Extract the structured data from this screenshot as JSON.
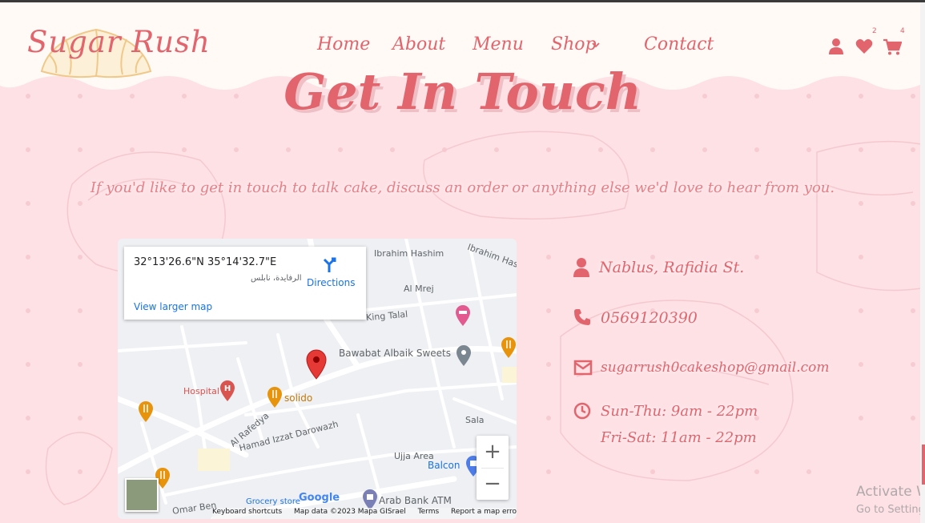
{
  "colors": {
    "accent": "#e2646d",
    "background": "#fde1e5",
    "header_bg": "#fffaf6",
    "link_blue": "#1a73e8"
  },
  "header": {
    "logo_text": "Sugar Rush",
    "nav": [
      {
        "label": "Home"
      },
      {
        "label": "About"
      },
      {
        "label": "Menu"
      },
      {
        "label": "Shop"
      },
      {
        "label": "Contact"
      }
    ],
    "shop_dropdown_icon": "chevron-down-icon",
    "icons": {
      "user": "user-icon",
      "wishlist": "heart-icon",
      "cart": "cart-icon"
    },
    "wishlist_count": "2",
    "cart_count": "4"
  },
  "hero": {
    "title": "Get In Touch",
    "subtitle": "If you'd like to get in touch to talk cake, discuss an order or anything else we'd love to hear from you."
  },
  "map": {
    "coordinates": "32°13'26.6\"N 35°14'32.7\"E",
    "address": "الرفايدة، نابلس",
    "directions_label": "Directions",
    "view_larger_label": "View larger map",
    "road_labels": [
      "Ibrahim Hashim",
      "Ibrahim Hash",
      "Al Mrej",
      "King Talal",
      "Al Rafedya",
      "Hamad Izzat Darowazh",
      "Ujja Area",
      "Sala",
      "Omar Ben"
    ],
    "pois": [
      {
        "label": "Bawabat Albaik Sweets",
        "color": "#5f6368"
      },
      {
        "label": "Hospital",
        "color": "#d9534f"
      },
      {
        "label": "solido",
        "color": "#e8930c"
      },
      {
        "label": "Balcon",
        "color": "#1a73e8"
      },
      {
        "label": "Arab Bank ATM",
        "color": "#5f6368"
      },
      {
        "label": "Grocery store",
        "color": "#1a73e8"
      }
    ],
    "zoom_in": "+",
    "zoom_out": "−",
    "footer": [
      "Keyboard shortcuts",
      "Map data ©2023 Mapa GISrael",
      "Terms",
      "Report a map error"
    ],
    "google_logo": "Google"
  },
  "contact": {
    "location": "Nablus, Rafidia St.",
    "phone": "0569120390",
    "email": "sugarrush0cakeshop@gmail.com",
    "hours_weekday": "Sun-Thu: 9am - 22pm",
    "hours_weekend": "Fri-Sat: 11am - 22pm"
  },
  "os_overlay": {
    "activate_title": "Activate W",
    "activate_sub": "Go to Setting"
  }
}
